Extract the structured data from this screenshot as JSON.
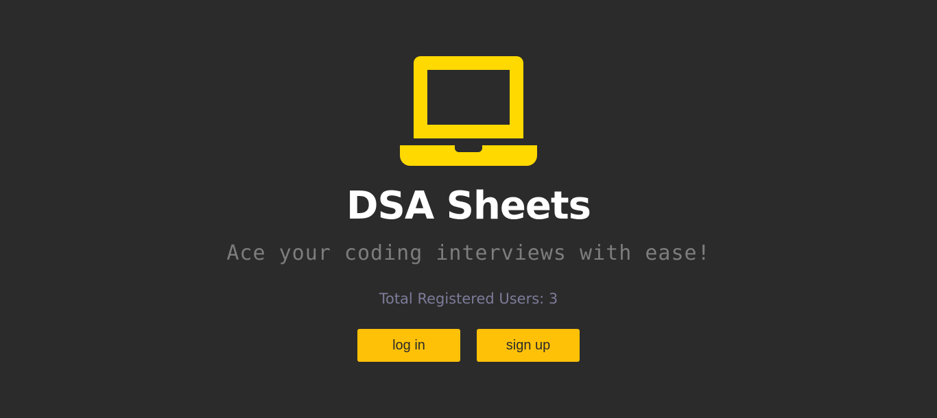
{
  "logo": {
    "icon": "laptop-icon",
    "color": "#ffd900"
  },
  "title": "DSA Sheets",
  "tagline": "Ace your coding interviews with ease!",
  "stats": {
    "registered_users": "Total Registered Users: 3"
  },
  "actions": {
    "login_label": "log in",
    "signup_label": "sign up",
    "accent": "#ffc107"
  },
  "colors": {
    "background": "#2b2b2b"
  }
}
